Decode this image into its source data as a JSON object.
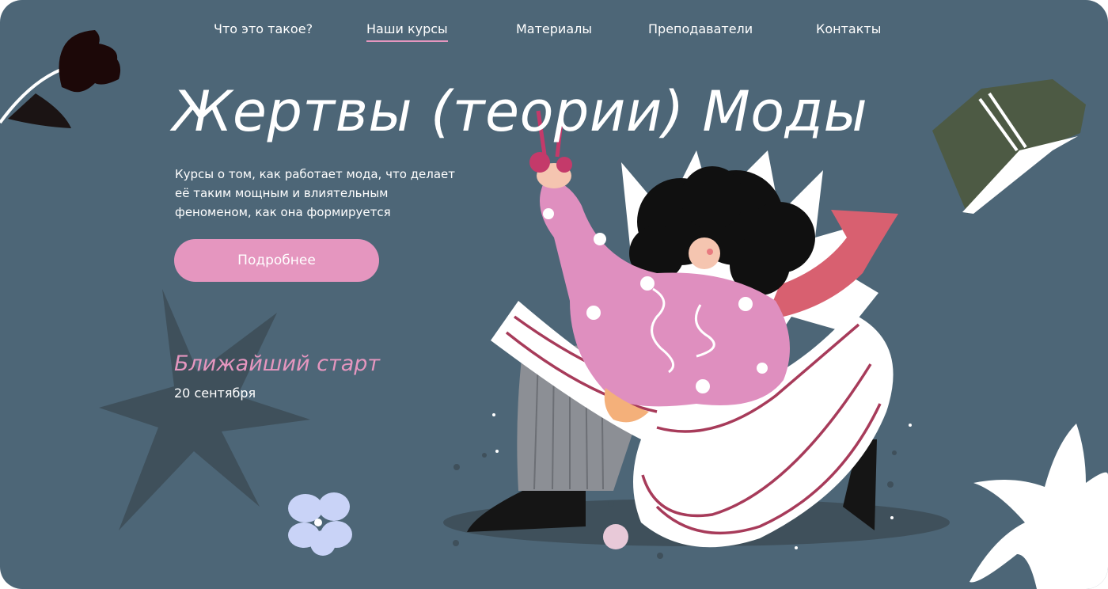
{
  "nav": {
    "items": [
      {
        "label": "Что это такое?"
      },
      {
        "label": "Наши курсы",
        "active": true
      },
      {
        "label": "Материалы"
      },
      {
        "label": "Преподаватели"
      },
      {
        "label": "Контакты"
      }
    ]
  },
  "hero": {
    "title": "Жертвы (теории) Моды",
    "subtitle": "Курсы о том, как работает мода, что делает её таким мощным и влиятельным феноменом, как она формируется",
    "cta_label": "Подробнее",
    "start_label": "Ближайший старт",
    "start_date": "20 сентября"
  },
  "colors": {
    "background": "#4d6677",
    "accent_pink": "#e596bf",
    "text": "#ffffff",
    "dark_shape": "#3f505b",
    "book_green": "#4d5a44",
    "scarf_red": "#d86070"
  },
  "illustration": {
    "elements": [
      "tulip-icon",
      "open-book-icon",
      "star-shape",
      "flower-icon",
      "woman-with-scissors-illustration"
    ]
  }
}
